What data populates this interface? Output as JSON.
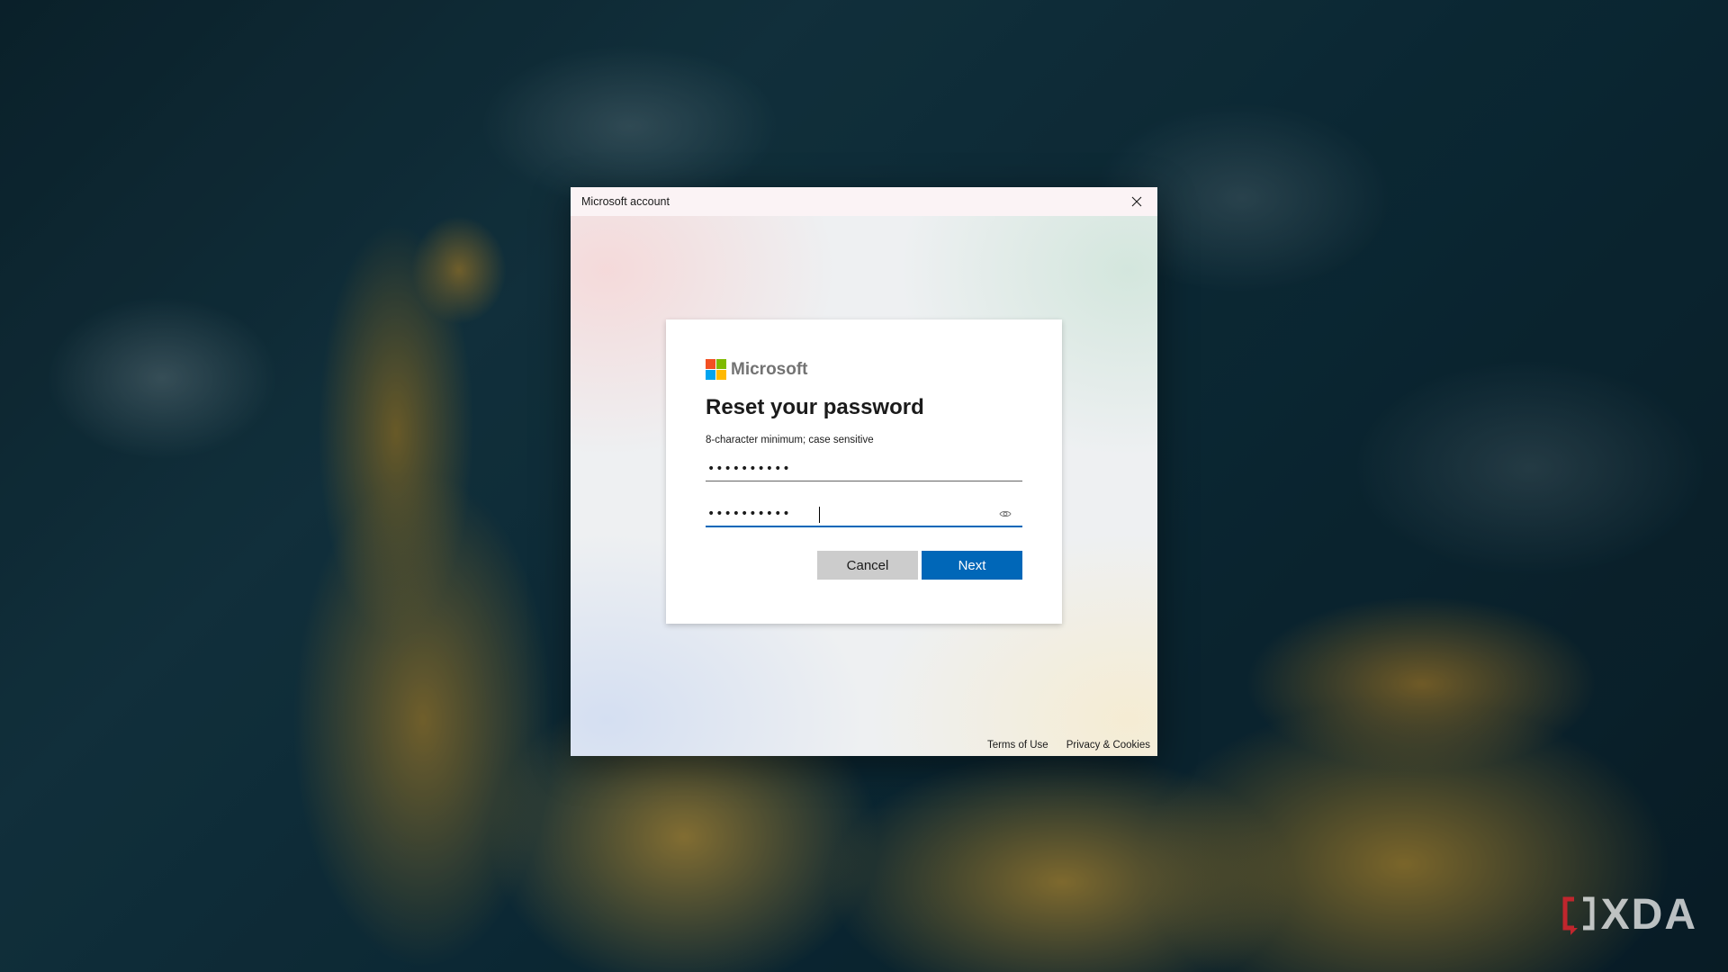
{
  "window": {
    "title": "Microsoft account"
  },
  "card": {
    "brand": "Microsoft",
    "heading": "Reset your password",
    "hint": "8-character minimum; case sensitive",
    "new_password_value": "••••••••••",
    "confirm_password_value": "••••••••••",
    "buttons": {
      "cancel": "Cancel",
      "next": "Next"
    }
  },
  "footer": {
    "terms": "Terms of Use",
    "privacy": "Privacy & Cookies"
  },
  "watermark": {
    "text": "XDA"
  },
  "colors": {
    "accent": "#0067b8",
    "logo_red": "#f25022",
    "logo_green": "#7fba00",
    "logo_blue": "#00a4ef",
    "logo_yellow": "#ffb900",
    "watermark_red": "#c0262d"
  },
  "icons": [
    "close-icon",
    "microsoft-logo-icon",
    "eye-icon",
    "xda-logo-icon"
  ]
}
